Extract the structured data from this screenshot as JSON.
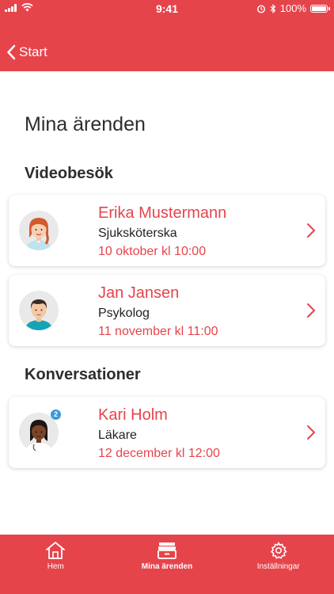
{
  "status_bar": {
    "time": "9:41",
    "battery": "100%"
  },
  "nav": {
    "back_label": "Start"
  },
  "page": {
    "title": "Mina ärenden"
  },
  "sections": [
    {
      "title": "Videobesök",
      "items": [
        {
          "name": "Erika Mustermann",
          "role": "Sjuksköterska",
          "date": "10 oktober kl 10:00",
          "avatar_icon": "nurse-avatar-icon",
          "badge": ""
        },
        {
          "name": "Jan Jansen",
          "role": "Psykolog",
          "date": "11 november kl 11:00",
          "avatar_icon": "psychologist-avatar-icon",
          "badge": ""
        }
      ]
    },
    {
      "title": "Konversationer",
      "items": [
        {
          "name": "Kari Holm",
          "role": "Läkare",
          "date": "12 december kl 12:00",
          "avatar_icon": "doctor-avatar-icon",
          "badge": "2"
        }
      ]
    }
  ],
  "tabs": [
    {
      "label": "Hem",
      "icon": "home-icon",
      "active": false
    },
    {
      "label": "Mina ärenden",
      "icon": "inbox-icon",
      "active": true
    },
    {
      "label": "Inställningar",
      "icon": "gear-icon",
      "active": false
    }
  ],
  "colors": {
    "brand_red": "#e6444b",
    "badge_blue": "#3a9ad9"
  }
}
